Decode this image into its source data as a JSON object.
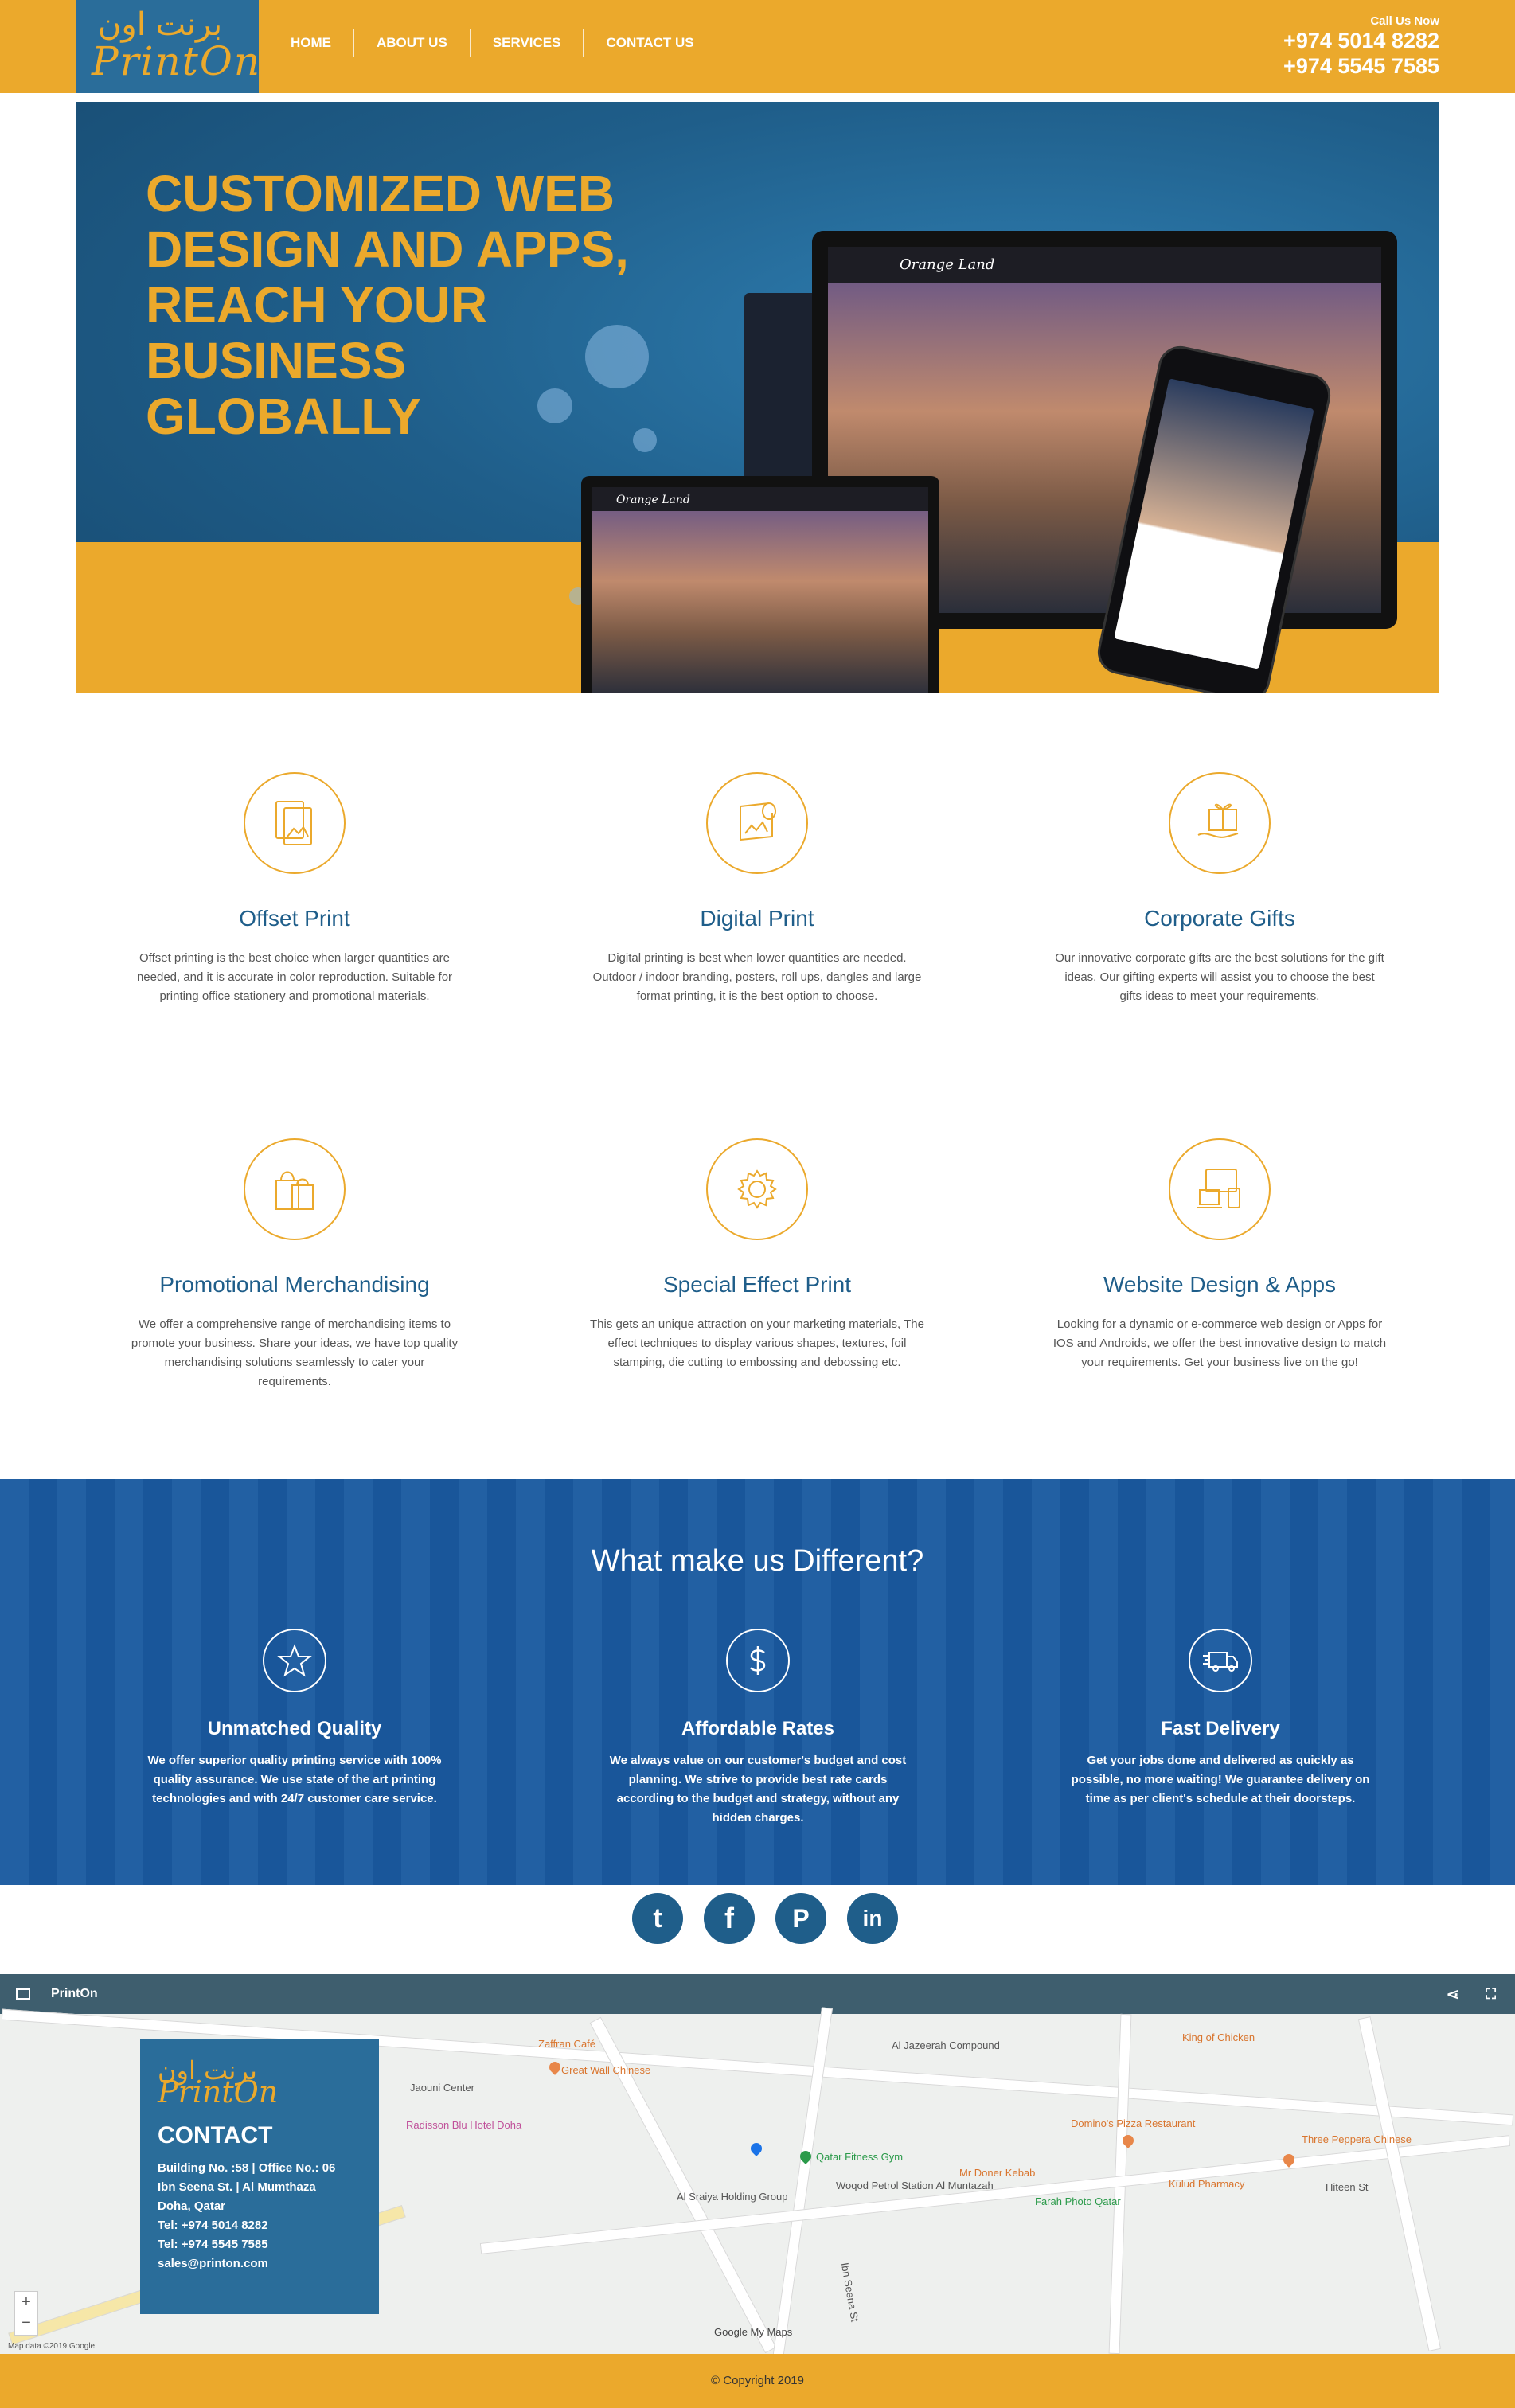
{
  "header": {
    "logo_arabic": "برنت اون",
    "logo_latin": "PrintOn",
    "nav": [
      "HOME",
      "ABOUT US",
      "SERVICES",
      "CONTACT US"
    ],
    "call_label": "Call Us Now",
    "phones": [
      "+974 5014 8282",
      "+974 5545 7585"
    ]
  },
  "hero": {
    "title_lines": [
      "CUSTOMIZED WEB",
      "DESIGN AND APPS,",
      "REACH YOUR",
      "BUSINESS",
      "GLOBALLY"
    ],
    "mock_brand": "Orange Land"
  },
  "services": [
    {
      "icon": "offset-print-icon",
      "title": "Offset Print",
      "text": "Offset printing is the best choice when larger quantities are needed, and it is accurate in color reproduction. Suitable for printing office stationery and promotional materials."
    },
    {
      "icon": "digital-print-icon",
      "title": "Digital Print",
      "text": "Digital printing is best when lower quantities are needed. Outdoor / indoor branding, posters, roll ups, dangles and large format printing, it is the best option to choose."
    },
    {
      "icon": "gift-icon",
      "title": "Corporate Gifts",
      "text": "Our innovative corporate gifts are the best solutions for the gift ideas. Our gifting experts will assist you to choose the best gifts ideas to meet your requirements."
    },
    {
      "icon": "shopping-bag-icon",
      "title": "Promotional Merchandising",
      "text": "We offer a comprehensive range of merchandising items to promote your business. Share your ideas, we have top quality merchandising solutions seamlessly to cater your requirements."
    },
    {
      "icon": "gear-icon",
      "title": "Special Effect Print",
      "text": "This gets an unique attraction on your marketing materials, The effect techniques to display various shapes, textures, foil stamping, die cutting to embossing and debossing etc."
    },
    {
      "icon": "devices-icon",
      "title": "Website Design & Apps",
      "text": "Looking for a dynamic or e-commerce web design or Apps for IOS and Androids, we offer the best innovative design to match your requirements. Get your business live on the go!"
    }
  ],
  "different": {
    "title": "What make us Different?",
    "features": [
      {
        "icon": "star-icon",
        "title": "Unmatched Quality",
        "text": "We offer superior quality printing service with 100% quality assurance. We use state of the art printing technologies and with 24/7 customer care service."
      },
      {
        "icon": "dollar-icon",
        "title": "Affordable Rates",
        "text": "We always value on our customer's budget and cost planning. We strive to provide best rate cards according to the budget and strategy, without any hidden charges."
      },
      {
        "icon": "delivery-truck-icon",
        "title": "Fast Delivery",
        "text": "Get your jobs done and delivered as quickly as possible, no more waiting! We guarantee delivery on time as per client's schedule at their doorsteps."
      }
    ]
  },
  "social": [
    {
      "icon": "twitter-icon",
      "glyph": "t"
    },
    {
      "icon": "facebook-icon",
      "glyph": "f"
    },
    {
      "icon": "pinterest-icon",
      "glyph": "P"
    },
    {
      "icon": "linkedin-icon",
      "glyph": "in"
    }
  ],
  "map": {
    "title": "PrintOn",
    "labels": [
      "Al Jazeerah Compound",
      "Zaffran Café",
      "Great Wall Chinese",
      "Jaouni Center",
      "Radisson Blu Hotel Doha",
      "Qatar Fitness Gym",
      "Al Sraiya Holding Group",
      "Woqod Petrol Station Al Muntazah",
      "Mr Doner Kebab",
      "Farah Photo Qatar",
      "Domino's Pizza Restaurant",
      "King of Chicken",
      "Kulud Pharmacy",
      "Three Peppera Chinese",
      "Hiteen St",
      "Ibn Seena St",
      "Google My Maps",
      "Map data ©2019 Google"
    ],
    "contact": {
      "title": "CONTACT",
      "lines": [
        "Building No. :58 | Office No.: 06",
        "Ibn Seena St. | Al Mumthaza",
        "Doha, Qatar",
        "Tel: +974 5014 8282",
        "Tel: +974 5545 7585",
        "sales@printon.com"
      ]
    }
  },
  "footer": {
    "text": "© Copyright 2019"
  },
  "colors": {
    "accent": "#eba92c",
    "primary": "#1f5e8a",
    "band": "#1a5aa0"
  }
}
